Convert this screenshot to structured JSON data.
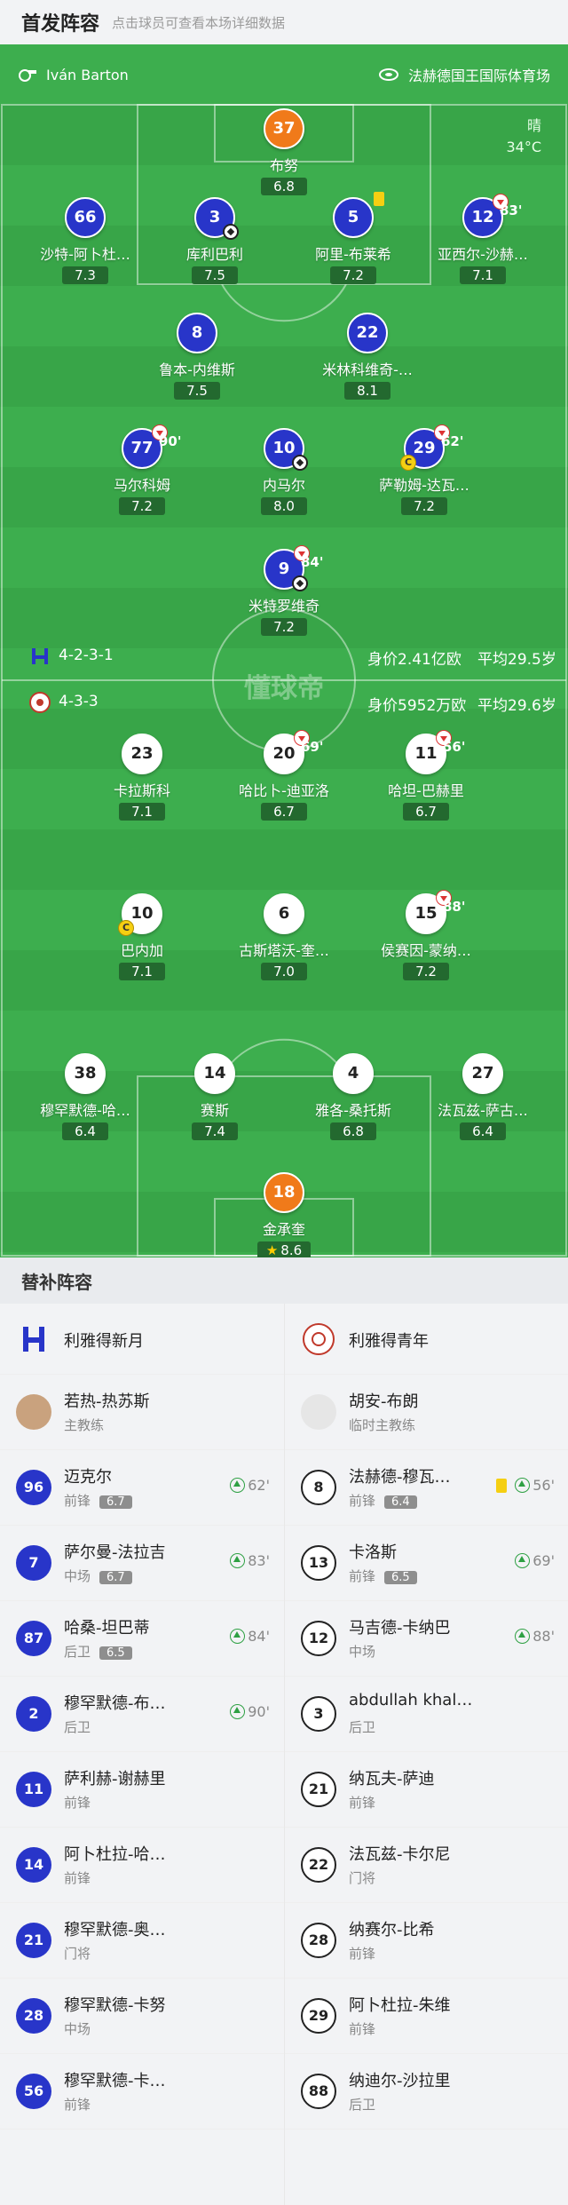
{
  "header": {
    "title": "首发阵容",
    "hint": "点击球员可查看本场详细数据"
  },
  "match": {
    "referee": "Iván Barton",
    "stadium": "法赫德国王国际体育场",
    "weather": "晴",
    "temperature": "34°C"
  },
  "home_info": {
    "formation": "4-2-3-1",
    "value": "身价2.41亿欧",
    "age": "平均29.5岁"
  },
  "away_info": {
    "formation": "4-3-3",
    "value": "身价5952万欧",
    "age": "平均29.6岁"
  },
  "watermark": "懂球帝",
  "home_players": [
    {
      "num": "37",
      "name": "布努",
      "rating": "6.8"
    },
    {
      "num": "66",
      "name": "沙特-阿卜杜…",
      "rating": "7.3"
    },
    {
      "num": "3",
      "name": "库利巴利",
      "rating": "7.5"
    },
    {
      "num": "5",
      "name": "阿里-布莱希",
      "rating": "7.2"
    },
    {
      "num": "12",
      "name": "亚西尔-沙赫…",
      "rating": "7.1",
      "sub": "83'"
    },
    {
      "num": "8",
      "name": "鲁本-内维斯",
      "rating": "7.5"
    },
    {
      "num": "22",
      "name": "米林科维奇-…",
      "rating": "8.1"
    },
    {
      "num": "77",
      "name": "马尔科姆",
      "rating": "7.2",
      "sub": "90'"
    },
    {
      "num": "10",
      "name": "内马尔",
      "rating": "8.0"
    },
    {
      "num": "29",
      "name": "萨勒姆-达瓦…",
      "rating": "7.2",
      "sub": "62'"
    },
    {
      "num": "9",
      "name": "米特罗维奇",
      "rating": "7.2",
      "sub": "84'"
    }
  ],
  "away_players": [
    {
      "num": "23",
      "name": "卡拉斯科",
      "rating": "7.1"
    },
    {
      "num": "20",
      "name": "哈比卜-迪亚洛",
      "rating": "6.7",
      "sub": "69'"
    },
    {
      "num": "11",
      "name": "哈坦-巴赫里",
      "rating": "6.7",
      "sub": "56'"
    },
    {
      "num": "10",
      "name": "巴内加",
      "rating": "7.1"
    },
    {
      "num": "6",
      "name": "古斯塔沃-奎…",
      "rating": "7.0"
    },
    {
      "num": "15",
      "name": "侯赛因-蒙纳…",
      "rating": "7.2",
      "sub": "88'"
    },
    {
      "num": "38",
      "name": "穆罕默德-哈…",
      "rating": "6.4"
    },
    {
      "num": "14",
      "name": "赛斯",
      "rating": "7.4"
    },
    {
      "num": "4",
      "name": "雅各-桑托斯",
      "rating": "6.8"
    },
    {
      "num": "27",
      "name": "法瓦兹-萨古…",
      "rating": "6.4"
    },
    {
      "num": "18",
      "name": "金承奎",
      "rating": "8.6"
    }
  ],
  "subs": {
    "title": "替补阵容",
    "home_team": "利雅得新月",
    "away_team": "利雅得青年",
    "home_coach": {
      "name": "若热-热苏斯",
      "role": "主教练"
    },
    "away_coach": {
      "name": "胡安-布朗",
      "role": "临时主教练"
    },
    "home": [
      {
        "num": "96",
        "name": "迈克尔",
        "pos": "前锋",
        "rating": "6.7",
        "in": "62'"
      },
      {
        "num": "7",
        "name": "萨尔曼-法拉吉",
        "pos": "中场",
        "rating": "6.7",
        "in": "83'"
      },
      {
        "num": "87",
        "name": "哈桑-坦巴蒂",
        "pos": "后卫",
        "rating": "6.5",
        "in": "84'"
      },
      {
        "num": "2",
        "name": "穆罕默德-布…",
        "pos": "后卫",
        "rating": "",
        "in": "90'"
      },
      {
        "num": "11",
        "name": "萨利赫-谢赫里",
        "pos": "前锋",
        "rating": "",
        "in": ""
      },
      {
        "num": "14",
        "name": "阿卜杜拉-哈…",
        "pos": "前锋",
        "rating": "",
        "in": ""
      },
      {
        "num": "21",
        "name": "穆罕默德-奥…",
        "pos": "门将",
        "rating": "",
        "in": ""
      },
      {
        "num": "28",
        "name": "穆罕默德-卡努",
        "pos": "中场",
        "rating": "",
        "in": ""
      },
      {
        "num": "56",
        "name": "穆罕默德-卡…",
        "pos": "前锋",
        "rating": "",
        "in": ""
      }
    ],
    "away": [
      {
        "num": "8",
        "name": "法赫德-穆瓦…",
        "pos": "前锋",
        "rating": "6.4",
        "in": "56'",
        "card": true
      },
      {
        "num": "13",
        "name": "卡洛斯",
        "pos": "前锋",
        "rating": "6.5",
        "in": "69'"
      },
      {
        "num": "12",
        "name": "马吉德-卡纳巴",
        "pos": "中场",
        "rating": "",
        "in": "88'"
      },
      {
        "num": "3",
        "name": "abdullah khal…",
        "pos": "后卫",
        "rating": "",
        "in": ""
      },
      {
        "num": "21",
        "name": "纳瓦夫-萨迪",
        "pos": "前锋",
        "rating": "",
        "in": ""
      },
      {
        "num": "22",
        "name": "法瓦兹-卡尔尼",
        "pos": "门将",
        "rating": "",
        "in": ""
      },
      {
        "num": "28",
        "name": "纳赛尔-比希",
        "pos": "前锋",
        "rating": "",
        "in": ""
      },
      {
        "num": "29",
        "name": "阿卜杜拉-朱维",
        "pos": "前锋",
        "rating": "",
        "in": ""
      },
      {
        "num": "88",
        "name": "纳迪尔-沙拉里",
        "pos": "后卫",
        "rating": "",
        "in": ""
      }
    ]
  }
}
